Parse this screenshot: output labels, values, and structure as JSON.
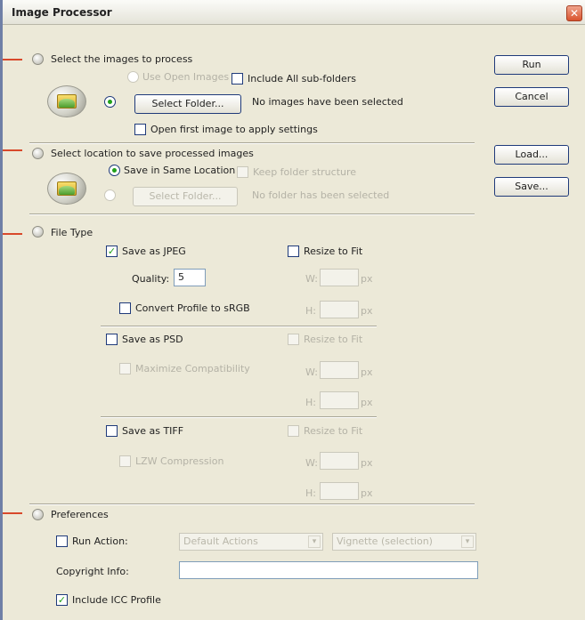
{
  "window": {
    "title": "Image Processor",
    "close_glyph": "✕"
  },
  "section1": {
    "label": "Select the images to process",
    "use_open_images": "Use Open Images",
    "include_subfolders": "Include All sub-folders",
    "select_folder": "Select Folder...",
    "status": "No images have been selected",
    "open_first": "Open first image to apply settings"
  },
  "section2": {
    "label": "Select location to save processed images",
    "save_same": "Save in Same Location",
    "keep_structure": "Keep folder structure",
    "select_folder": "Select Folder...",
    "status": "No folder has been selected"
  },
  "section3": {
    "label": "File Type",
    "jpeg": {
      "save": "Save as JPEG",
      "resize": "Resize to Fit",
      "quality_label": "Quality:",
      "quality_value": "5",
      "convert": "Convert Profile to sRGB",
      "w": "W:",
      "h": "H:",
      "px": "px"
    },
    "psd": {
      "save": "Save as PSD",
      "resize": "Resize to Fit",
      "maximize": "Maximize Compatibility",
      "w": "W:",
      "h": "H:",
      "px": "px"
    },
    "tiff": {
      "save": "Save as TIFF",
      "resize": "Resize to Fit",
      "lzw": "LZW Compression",
      "w": "W:",
      "h": "H:",
      "px": "px"
    }
  },
  "section4": {
    "label": "Preferences",
    "run_action": "Run Action:",
    "action_set": "Default Actions",
    "action": "Vignette (selection)",
    "copyright": "Copyright Info:",
    "icc": "Include ICC Profile"
  },
  "buttons": {
    "run": "Run",
    "cancel": "Cancel",
    "load": "Load...",
    "save": "Save..."
  },
  "state": {
    "include_subfolders": false,
    "open_first": false,
    "save_jpeg": true,
    "resize_jpeg": false,
    "convert_srgb": false,
    "save_psd": false,
    "save_tiff": false,
    "run_action": false,
    "include_icc": true,
    "source_radio": "folder",
    "dest_radio": "same"
  },
  "icons": {
    "check": "✓",
    "arrow": "▾",
    "folder": "folder-icon"
  },
  "colors": {
    "accent": "#21a11b",
    "marker": "#d8492b",
    "border": "#1f3a7a"
  }
}
